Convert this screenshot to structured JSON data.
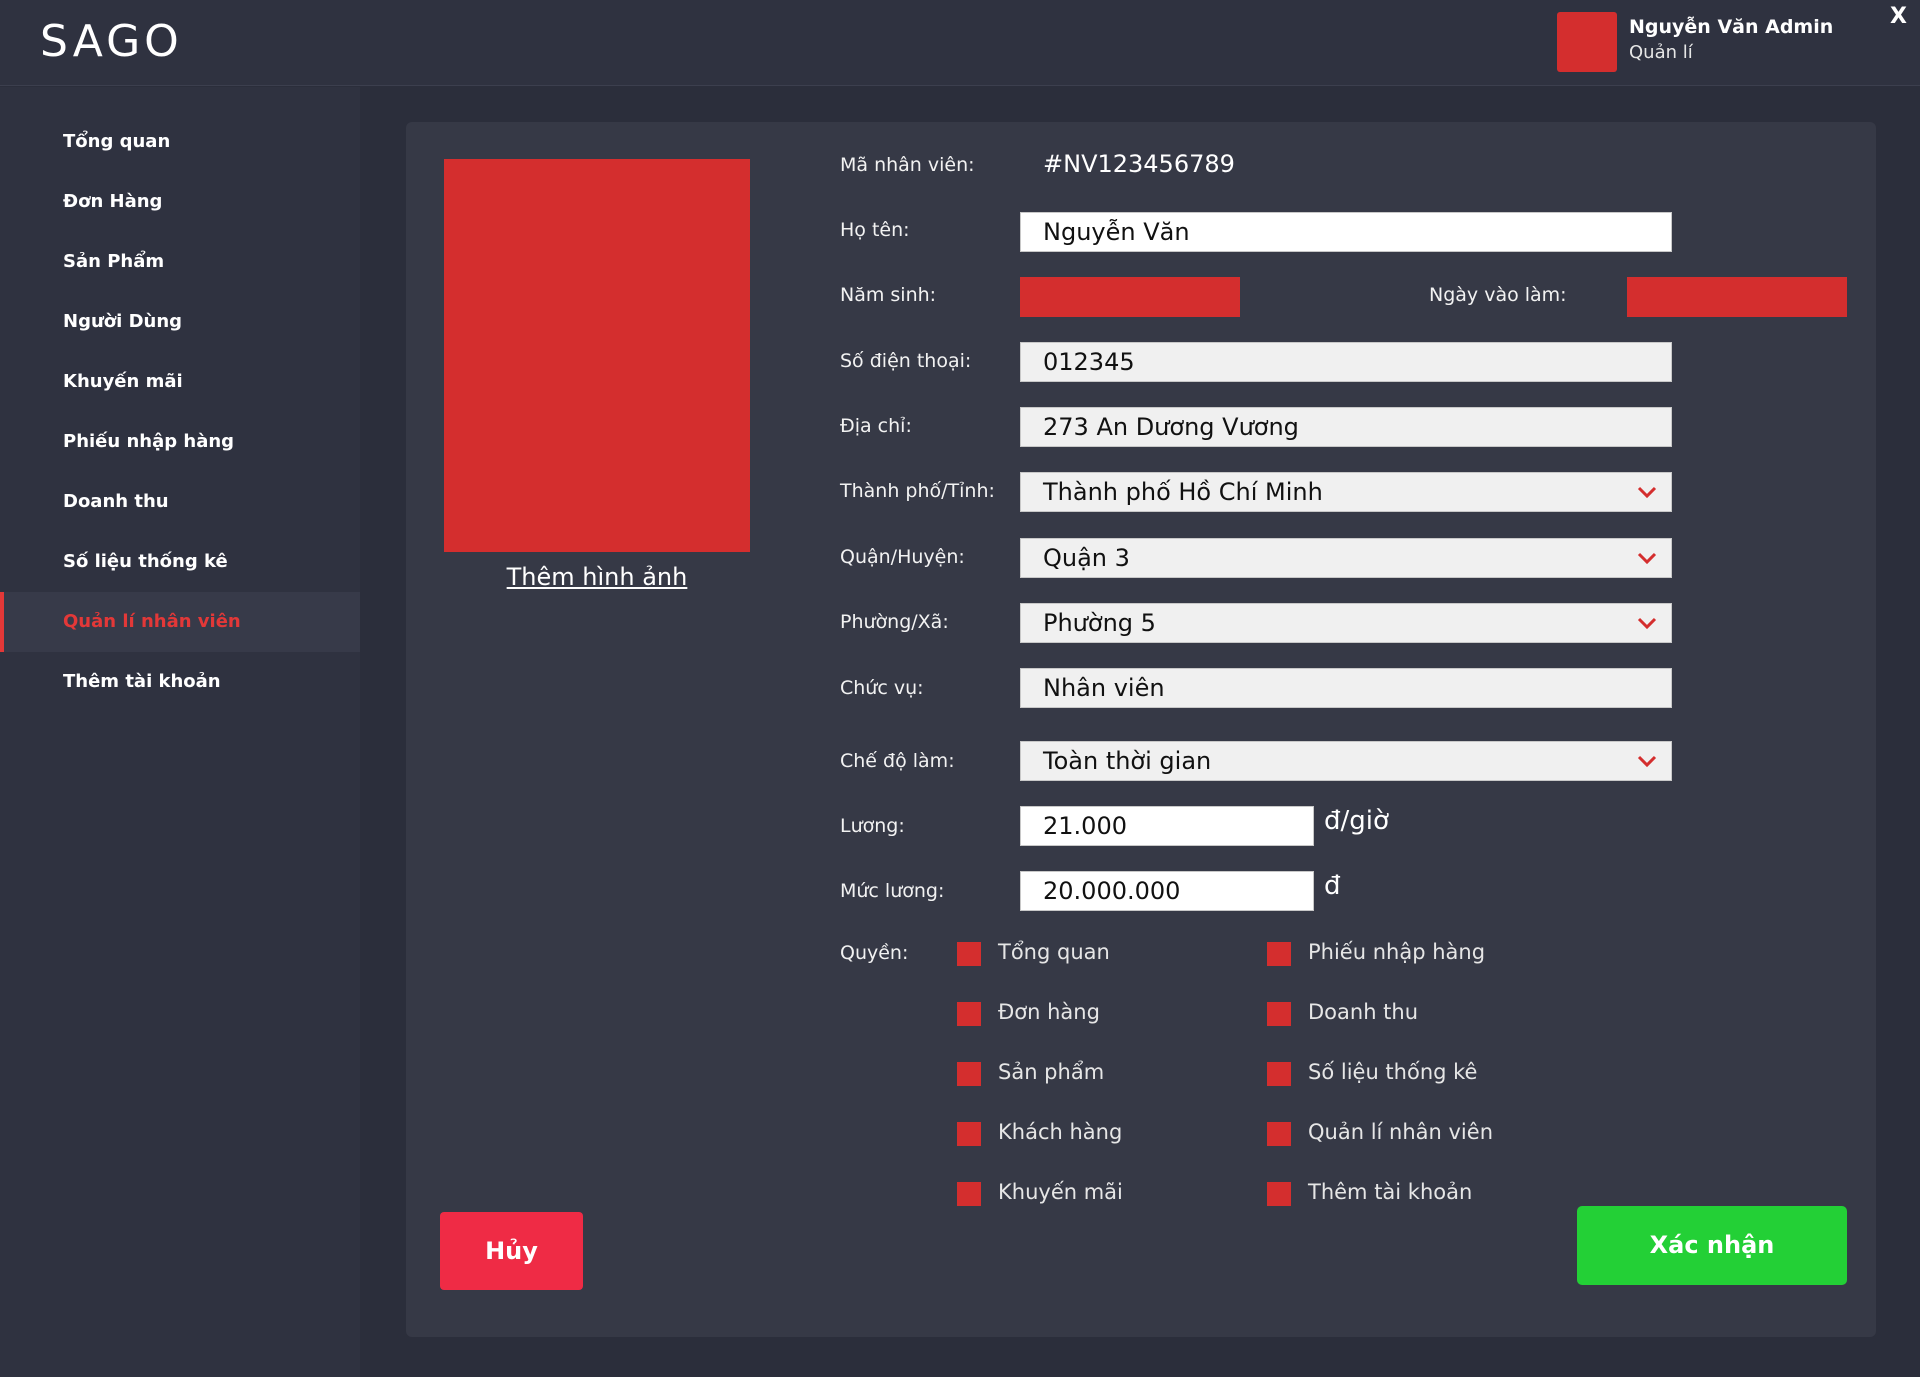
{
  "header": {
    "logo": "SAGO",
    "user_name": "Nguyễn Văn Admin",
    "user_role": "Quản lí",
    "close_label": "X"
  },
  "sidebar": {
    "items": [
      {
        "label": "Tổng quan"
      },
      {
        "label": "Đơn Hàng"
      },
      {
        "label": "Sản Phẩm"
      },
      {
        "label": "Người Dùng"
      },
      {
        "label": "Khuyến mãi"
      },
      {
        "label": "Phiếu nhập hàng"
      },
      {
        "label": "Doanh thu"
      },
      {
        "label": "Số liệu thống kê"
      },
      {
        "label": "Quản lí nhân viên"
      },
      {
        "label": "Thêm tài khoản"
      }
    ],
    "active_item": "Quản lí nhân viên"
  },
  "form": {
    "add_photo_label": "Thêm hình ảnh",
    "employee_id": {
      "label": "Mã nhân viên:",
      "value": "#NV123456789"
    },
    "full_name": {
      "label": "Họ tên:",
      "value": "Nguyễn Văn"
    },
    "birth_year": {
      "label": "Năm sinh:"
    },
    "start_date": {
      "label": "Ngày vào làm:"
    },
    "phone": {
      "label": "Số điện thoại:",
      "value": "012345"
    },
    "address": {
      "label": "Địa chỉ:",
      "value": "273 An Dương Vương"
    },
    "city": {
      "label": "Thành phố/Tỉnh:",
      "value": "Thành phố Hồ Chí Minh"
    },
    "district": {
      "label": "Quận/Huyện:",
      "value": "Quận 3"
    },
    "ward": {
      "label": "Phường/Xã:",
      "value": "Phường 5"
    },
    "position": {
      "label": "Chức vụ:",
      "value": "Nhân viên"
    },
    "work_mode": {
      "label": "Chế độ làm:",
      "value": "Toàn thời gian"
    },
    "wage": {
      "label": "Lương:",
      "value": "21.000",
      "unit": "đ/giờ"
    },
    "salary": {
      "label": "Mức lương:",
      "value": "20.000.000",
      "unit": "đ"
    },
    "permissions": {
      "label": "Quyền:",
      "left": [
        "Tổng quan",
        "Đơn hàng",
        "Sản phẩm",
        "Khách hàng",
        "Khuyến mãi"
      ],
      "right": [
        "Phiếu nhập hàng",
        "Doanh thu",
        "Số liệu thống kê",
        "Quản lí nhân viên",
        "Thêm tài khoản"
      ]
    }
  },
  "actions": {
    "cancel_label": "Hủy",
    "confirm_label": "Xác nhận"
  },
  "colors": {
    "accent_red": "#d42e2e",
    "cancel": "#ef2b45",
    "confirm": "#23d036",
    "background": "#2b2e3b"
  }
}
